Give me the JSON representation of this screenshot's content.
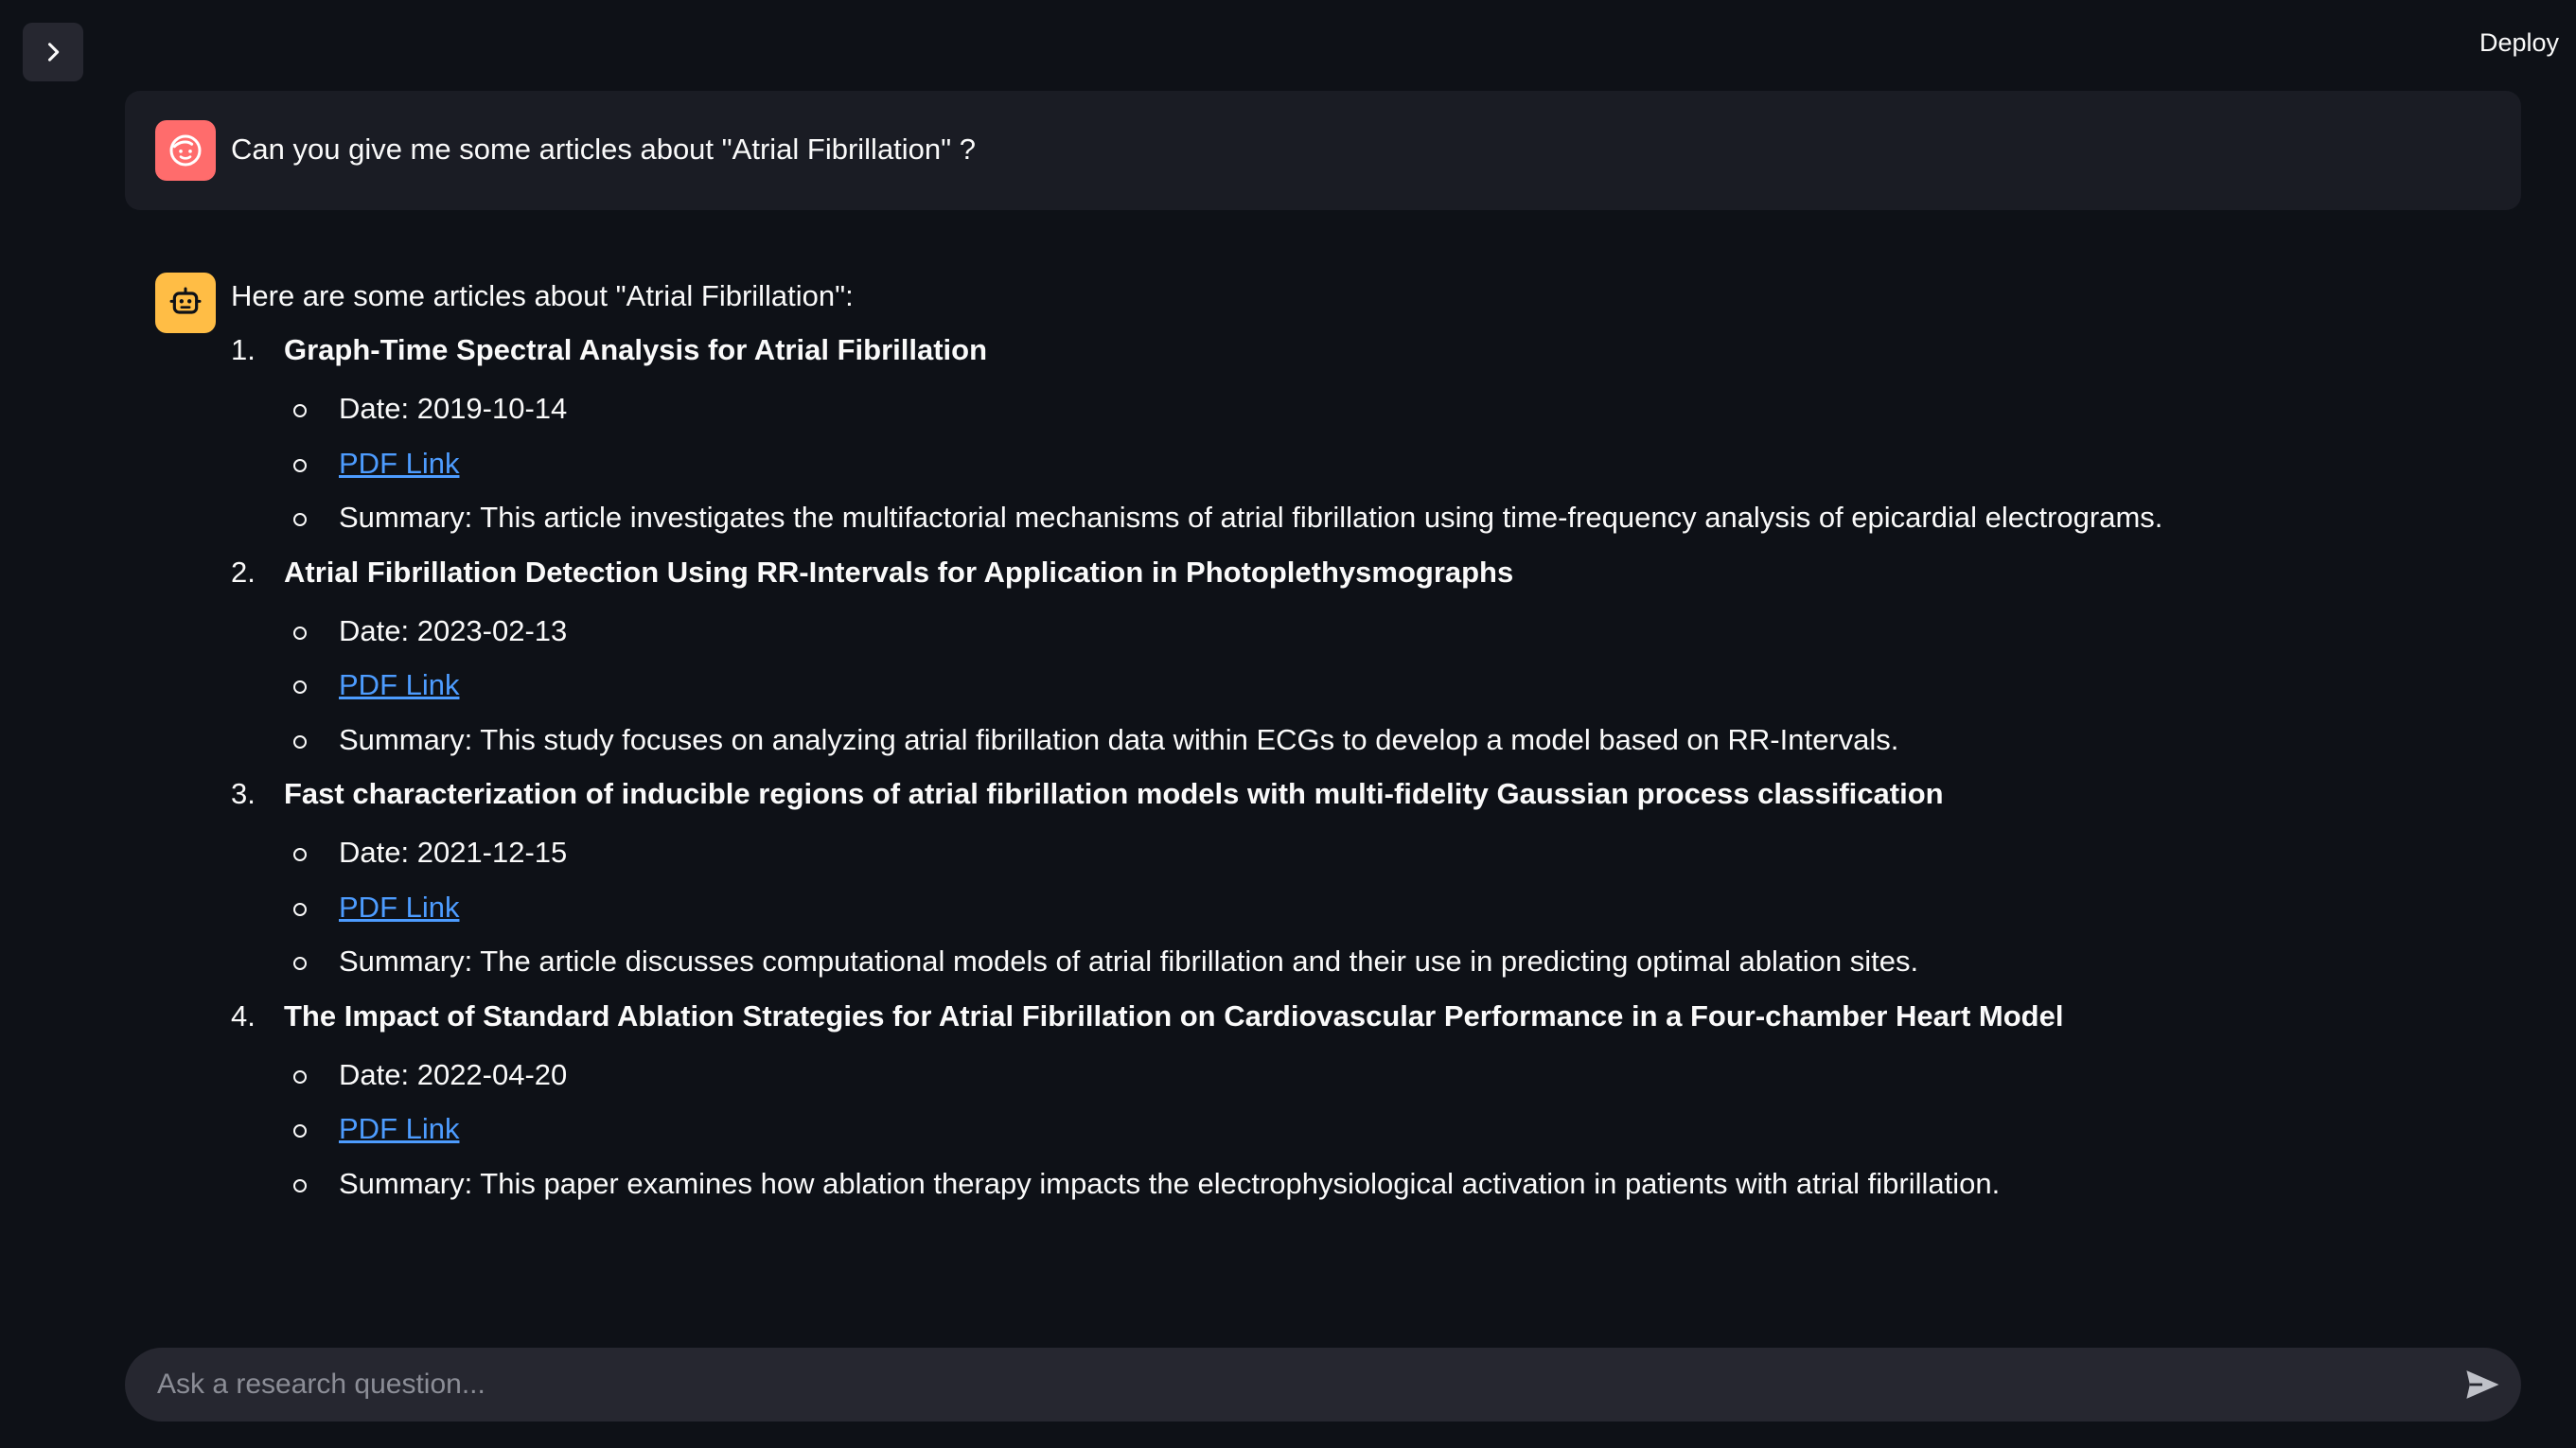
{
  "header": {
    "deploy_label": "Deploy"
  },
  "user_message": {
    "text": "Can you give me some articles about \"Atrial Fibrillation\" ?"
  },
  "assistant_message": {
    "intro": "Here are some articles about \"Atrial Fibrillation\":",
    "articles": [
      {
        "number": "1.",
        "title": "Graph-Time Spectral Analysis for Atrial Fibrillation",
        "date": "Date: 2019-10-14",
        "pdf_link": "PDF Link",
        "summary": "Summary: This article investigates the multifactorial mechanisms of atrial fibrillation using time-frequency analysis of epicardial electrograms."
      },
      {
        "number": "2.",
        "title": "Atrial Fibrillation Detection Using RR-Intervals for Application in Photoplethysmographs",
        "date": "Date: 2023-02-13",
        "pdf_link": "PDF Link",
        "summary": "Summary: This study focuses on analyzing atrial fibrillation data within ECGs to develop a model based on RR-Intervals."
      },
      {
        "number": "3.",
        "title": "Fast characterization of inducible regions of atrial fibrillation models with multi-fidelity Gaussian process classification",
        "date": "Date: 2021-12-15",
        "pdf_link": "PDF Link",
        "summary": "Summary: The article discusses computational models of atrial fibrillation and their use in predicting optimal ablation sites."
      },
      {
        "number": "4.",
        "title": "The Impact of Standard Ablation Strategies for Atrial Fibrillation on Cardiovascular Performance in a Four-chamber Heart Model",
        "date": "Date: 2022-04-20",
        "pdf_link": "PDF Link",
        "summary": "Summary: This paper examines how ablation therapy impacts the electrophysiological activation in patients with atrial fibrillation."
      }
    ]
  },
  "chat_input": {
    "placeholder": "Ask a research question..."
  },
  "icons": {
    "sidebar_toggle": "chevron-right-icon",
    "user_avatar": "face-icon",
    "assistant_avatar": "robot-icon",
    "send": "send-icon"
  },
  "colors": {
    "background": "#0e1117",
    "user_avatar": "#ff6c6c",
    "assistant_avatar": "#ffbd45",
    "link": "#4d9cff"
  }
}
